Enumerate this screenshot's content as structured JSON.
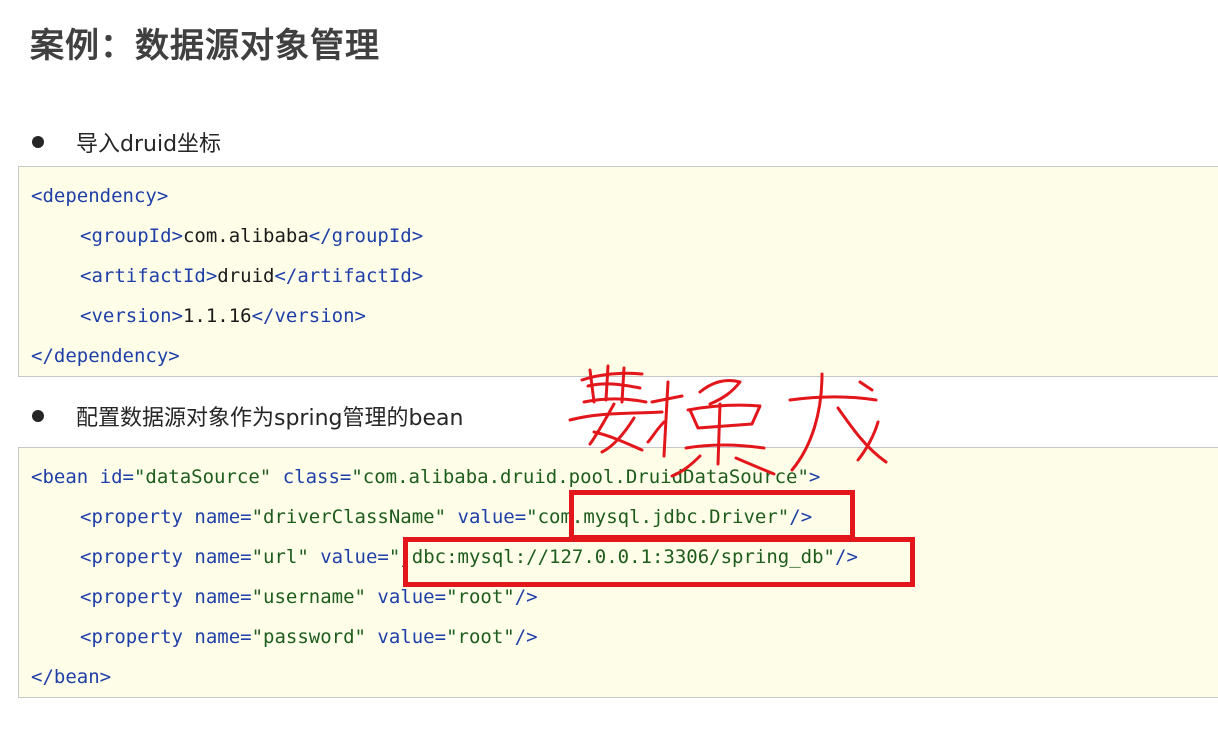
{
  "title": "案例：数据源对象管理",
  "bullets": [
    "导入druid坐标",
    "配置数据源对象作为spring管理的bean"
  ],
  "dependency": {
    "open": "<dependency>",
    "group_open": "<groupId>",
    "group_val": "com.alibaba",
    "group_close": "</groupId>",
    "artifact_open": "<artifactId>",
    "artifact_val": "druid",
    "artifact_close": "</artifactId>",
    "version_open": "<version>",
    "version_val": "1.1.16",
    "version_close": "</version>",
    "close": "</dependency>"
  },
  "bean": {
    "tag_open": "<bean",
    "id_attr": " id=",
    "id_val": "\"dataSource\"",
    "class_attr": " class=",
    "class_val": "\"com.alibaba.druid.pool.DruidDataSource\"",
    "tag_end": ">",
    "properties": [
      {
        "tag": "<property",
        "name_attr": " name=",
        "name_val": "\"driverClassName\"",
        "value_attr": " value=",
        "value_val": "\"com.mysql.jdbc.Driver\"",
        "end": "/>"
      },
      {
        "tag": "<property",
        "name_attr": " name=",
        "name_val": "\"url\"",
        "value_attr": " value=",
        "value_val": "\"jdbc:mysql://127.0.0.1:3306/spring_db\"",
        "end": "/>"
      },
      {
        "tag": "<property",
        "name_attr": " name=",
        "name_val": "\"username\"",
        "value_attr": " value=",
        "value_val": "\"root\"",
        "end": "/>"
      },
      {
        "tag": "<property",
        "name_attr": " name=",
        "name_val": "\"password\"",
        "value_attr": " value=",
        "value_val": "\"root\"",
        "end": "/>"
      }
    ],
    "close": "</bean>"
  },
  "annotation": {
    "handwritten_text": "要换成",
    "color": "#e3161c"
  },
  "colors": {
    "code_bg": "#fefee8",
    "tag": "#1f3fa8",
    "string": "#1d5c1d",
    "highlight": "#e3161c"
  }
}
